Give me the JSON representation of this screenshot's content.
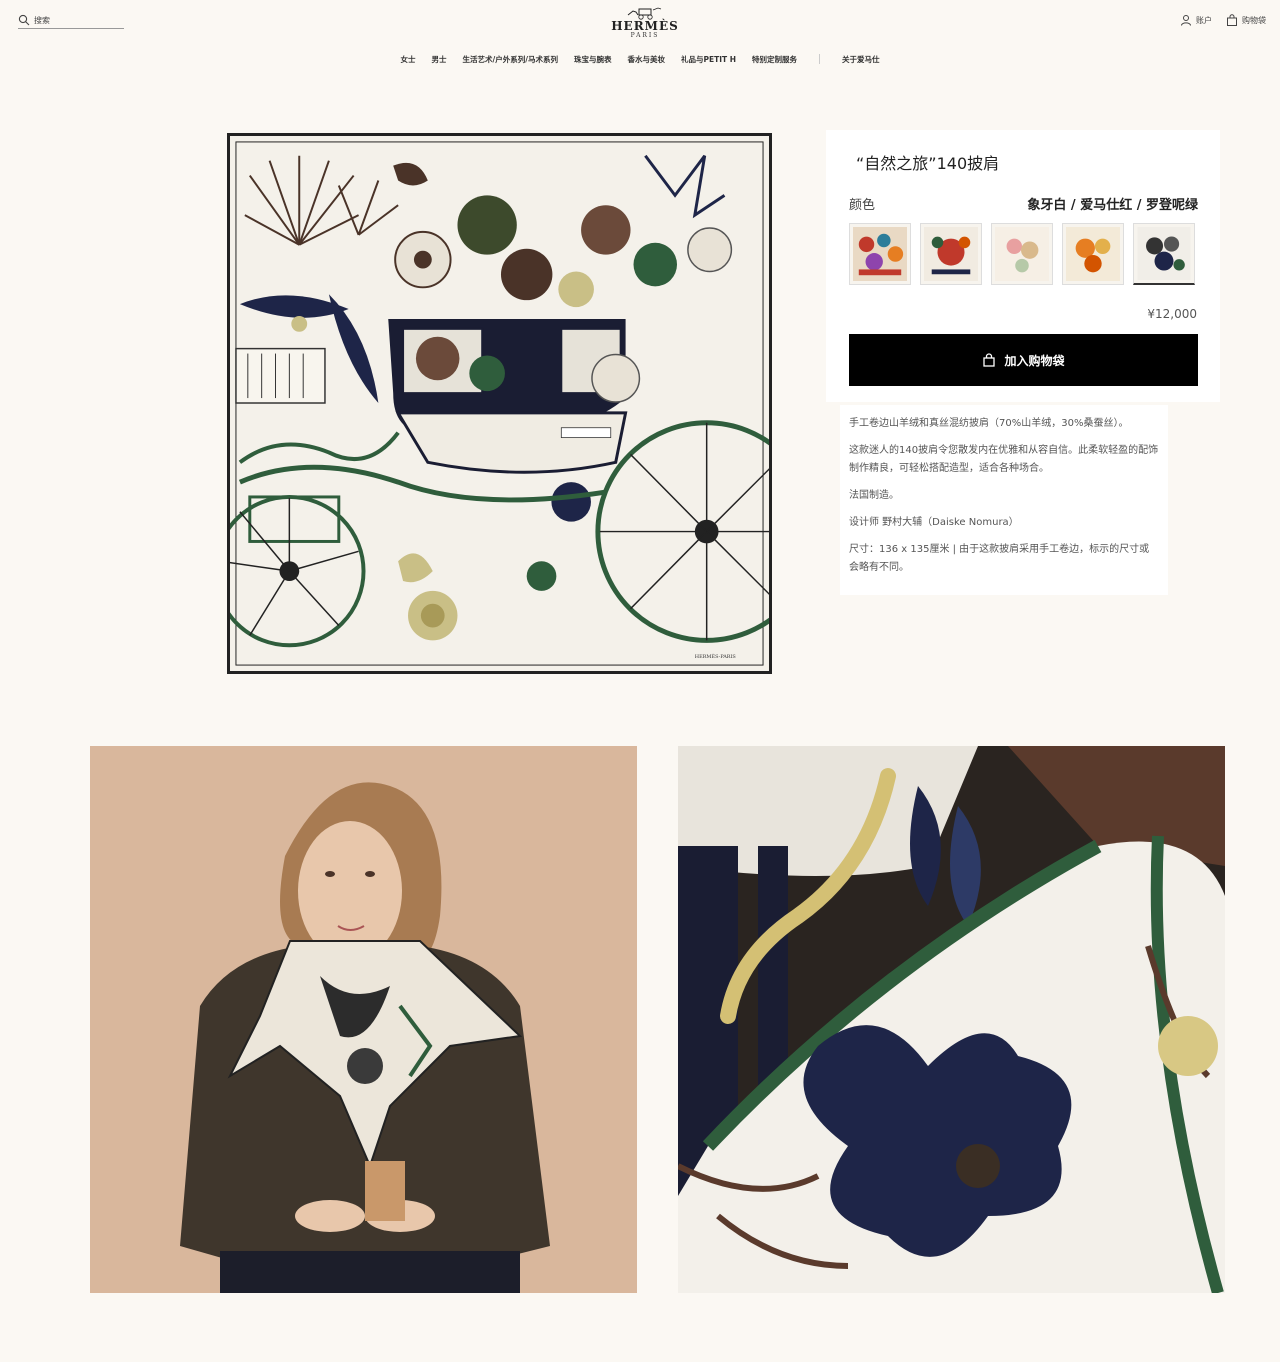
{
  "header": {
    "search_label": "搜索",
    "brand": "HERMÈS",
    "city": "PARIS",
    "account_label": "账户",
    "cart_label": "购物袋"
  },
  "nav": {
    "items": [
      "女士",
      "男士",
      "生活艺术/户外系列/马术系列",
      "珠宝与腕表",
      "香水与美妆",
      "礼品与PETIT H",
      "特别定制服务",
      "关于爱马仕"
    ]
  },
  "product": {
    "title": "“自然之旅”140披肩",
    "color_label": "颜色",
    "color_value": "象牙白 / 爱马仕红 / 罗登呢绿",
    "swatch_names": [
      "swatch-1",
      "swatch-2",
      "swatch-3",
      "swatch-4",
      "swatch-5"
    ],
    "price": "¥12,000",
    "add_to_cart": "加入购物袋",
    "description": [
      "手工卷边山羊绒和真丝混纺披肩（70%山羊绒，30%桑蚕丝）。",
      "这款迷人的140披肩令您散发内在优雅和从容自信。此柔软轻盈的配饰制作精良，可轻松搭配造型，适合各种场合。",
      "法国制造。",
      "设计师 野村大辅（Daiske Nomura）",
      "尺寸：136 x 135厘米 | 由于这款披肩采用手工卷边，标示的尺寸或会略有不同。"
    ],
    "scarf_signature": "HERMÈS-PARIS"
  },
  "colors": {
    "background": "#fbf8f3",
    "button": "#000000",
    "scarf_green": "#2f5d3c",
    "scarf_navy": "#1e2548",
    "scarf_brown": "#4a3328"
  }
}
